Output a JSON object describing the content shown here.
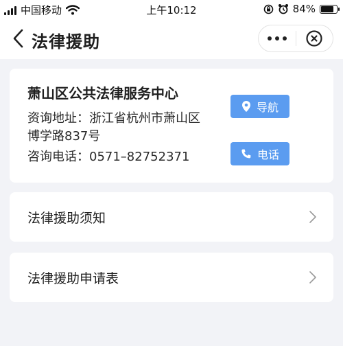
{
  "status_bar": {
    "carrier": "中国移动",
    "time": "上午10:12",
    "battery_percent": "84%",
    "battery_level": 0.84,
    "icons": [
      "signal-icon",
      "wifi-icon",
      "rotation-lock-icon",
      "alarm-icon",
      "battery-icon"
    ]
  },
  "nav": {
    "title": "法律援助",
    "icons": [
      "back-icon",
      "more-icon",
      "close-icon"
    ]
  },
  "center": {
    "name": "萧山区公共法律服务中心",
    "address_line1": "资询地址：浙江省杭州市萧山区",
    "address_line2": "博学路837号",
    "phone_line": "咨询电话：0571–82752371",
    "navigate_label": "导航",
    "call_label": "电话"
  },
  "menu": {
    "items": [
      {
        "label": "法律援助须知"
      },
      {
        "label": "法律援助申请表"
      }
    ]
  },
  "colors": {
    "accent": "#5b9cf0",
    "background": "#f2f3f7",
    "card": "#ffffff"
  }
}
